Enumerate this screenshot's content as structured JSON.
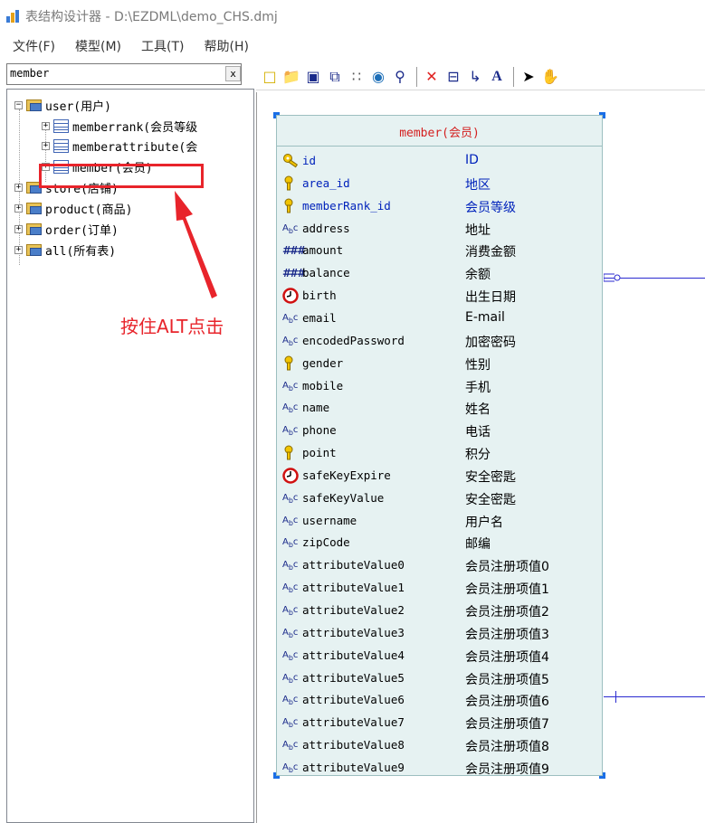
{
  "window": {
    "title": "表结构设计器 - D:\\EZDML\\demo_CHS.dmj"
  },
  "menu": [
    "文件(F)",
    "模型(M)",
    "工具(T)",
    "帮助(H)"
  ],
  "search": {
    "value": "member",
    "clear_label": "x"
  },
  "tree": {
    "groups": [
      {
        "label": "user(用户)",
        "expanded": true,
        "children": [
          {
            "label": "memberrank(会员等级"
          },
          {
            "label": "memberattribute(会"
          },
          {
            "label": "member(会员)"
          }
        ]
      },
      {
        "label": "store(店铺)",
        "expanded": false
      },
      {
        "label": "product(商品)",
        "expanded": false
      },
      {
        "label": "order(订单)",
        "expanded": false
      },
      {
        "label": "all(所有表)",
        "expanded": false
      }
    ]
  },
  "annotation": {
    "text": "按住ALT点击"
  },
  "toolbar": {
    "icons": [
      "new-file-icon",
      "open-folder-icon",
      "save-icon",
      "copy-window-icon",
      "grid-icon",
      "globe-icon",
      "find-icon",
      "delete-icon",
      "table-icon",
      "link-icon",
      "text-icon",
      "pointer-icon",
      "hand-icon"
    ]
  },
  "entity": {
    "title": "member(会员)",
    "fields": [
      {
        "name": "id",
        "label": "ID",
        "icon": "pk-key-icon",
        "key": true
      },
      {
        "name": "area_id",
        "label": "地区",
        "icon": "fk-key-icon",
        "key": true
      },
      {
        "name": "memberRank_id",
        "label": "会员等级",
        "icon": "fk-key-icon",
        "key": true
      },
      {
        "name": "address",
        "label": "地址",
        "icon": "string-icon",
        "key": false
      },
      {
        "name": "amount",
        "label": "消费金额",
        "icon": "number-icon",
        "key": false
      },
      {
        "name": "balance",
        "label": "余额",
        "icon": "number-icon",
        "key": false
      },
      {
        "name": "birth",
        "label": "出生日期",
        "icon": "date-icon",
        "key": false
      },
      {
        "name": "email",
        "label": "E-mail",
        "icon": "string-icon",
        "key": false
      },
      {
        "name": "encodedPassword",
        "label": "加密密码",
        "icon": "string-icon",
        "key": false
      },
      {
        "name": "gender",
        "label": "性别",
        "icon": "enum-icon",
        "key": false
      },
      {
        "name": "mobile",
        "label": "手机",
        "icon": "string-icon",
        "key": false
      },
      {
        "name": "name",
        "label": "姓名",
        "icon": "string-icon",
        "key": false
      },
      {
        "name": "phone",
        "label": "电话",
        "icon": "string-icon",
        "key": false
      },
      {
        "name": "point",
        "label": "积分",
        "icon": "enum-icon",
        "key": false
      },
      {
        "name": "safeKeyExpire",
        "label": "安全密匙",
        "icon": "date-icon",
        "key": false
      },
      {
        "name": "safeKeyValue",
        "label": "安全密匙",
        "icon": "string-icon",
        "key": false
      },
      {
        "name": "username",
        "label": "用户名",
        "icon": "string-icon",
        "key": false
      },
      {
        "name": "zipCode",
        "label": "邮编",
        "icon": "string-icon",
        "key": false
      },
      {
        "name": "attributeValue0",
        "label": "会员注册项值0",
        "icon": "string-icon",
        "key": false
      },
      {
        "name": "attributeValue1",
        "label": "会员注册项值1",
        "icon": "string-icon",
        "key": false
      },
      {
        "name": "attributeValue2",
        "label": "会员注册项值2",
        "icon": "string-icon",
        "key": false
      },
      {
        "name": "attributeValue3",
        "label": "会员注册项值3",
        "icon": "string-icon",
        "key": false
      },
      {
        "name": "attributeValue4",
        "label": "会员注册项值4",
        "icon": "string-icon",
        "key": false
      },
      {
        "name": "attributeValue5",
        "label": "会员注册项值5",
        "icon": "string-icon",
        "key": false
      },
      {
        "name": "attributeValue6",
        "label": "会员注册项值6",
        "icon": "string-icon",
        "key": false
      },
      {
        "name": "attributeValue7",
        "label": "会员注册项值7",
        "icon": "string-icon",
        "key": false
      },
      {
        "name": "attributeValue8",
        "label": "会员注册项值8",
        "icon": "string-icon",
        "key": false
      },
      {
        "name": "attributeValue9",
        "label": "会员注册项值9",
        "icon": "string-icon",
        "key": false
      }
    ]
  },
  "colors": {
    "entity_bg": "#e6f2f2",
    "entity_title": "#d42020",
    "key_text": "#0022bb",
    "highlight": "#e8242b",
    "connector": "#2a2ad0"
  }
}
